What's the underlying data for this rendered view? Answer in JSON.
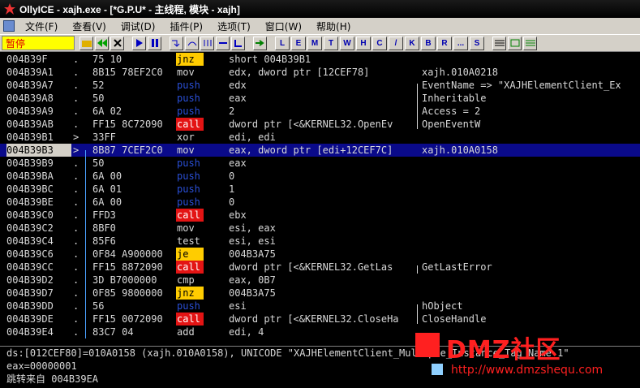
{
  "window": {
    "title": "OllyICE - xajh.exe - [*G.P.U* -  主线程, 模块 - xajh]"
  },
  "menu": [
    "文件(F)",
    "查看(V)",
    "调试(D)",
    "插件(P)",
    "选项(T)",
    "窗口(W)",
    "帮助(H)"
  ],
  "toolbar": {
    "status": "暂停",
    "letter_buttons": [
      "L",
      "E",
      "M",
      "T",
      "W",
      "H",
      "C",
      "/",
      "K",
      "B",
      "R",
      "...",
      "S"
    ]
  },
  "rows": [
    {
      "addr": "004B39F",
      "mark": ".",
      "hex": "75 10",
      "mnem": "jnz",
      "ops": "short 004B39B1",
      "cmt": "",
      "style": "jnz"
    },
    {
      "addr": "004B39A1",
      "mark": ".",
      "hex": "8B15 78EF2C0",
      "mnem": "mov",
      "ops": "edx, dword ptr [12CEF78]",
      "cmt": "xajh.010A0218",
      "style": "mov"
    },
    {
      "addr": "004B39A7",
      "mark": ".",
      "hex": "52",
      "mnem": "push",
      "ops": "edx",
      "cmt": "EventName => \"XAJHElementClient_Ex",
      "style": "push"
    },
    {
      "addr": "004B39A8",
      "mark": ".",
      "hex": "50",
      "mnem": "push",
      "ops": "eax",
      "cmt": "Inheritable",
      "style": "push"
    },
    {
      "addr": "004B39A9",
      "mark": ".",
      "hex": "6A 02",
      "mnem": "push",
      "ops": "2",
      "cmt": "Access = 2",
      "style": "push"
    },
    {
      "addr": "004B39AB",
      "mark": ".",
      "hex": "FF15 8C72090",
      "mnem": "call",
      "ops": "dword ptr [<&KERNEL32.OpenEv",
      "cmt": "OpenEventW",
      "style": "call"
    },
    {
      "addr": "004B39B1",
      "mark": ">",
      "hex": "33FF",
      "mnem": "xor",
      "ops": "edi, edi",
      "cmt": "",
      "style": "mov"
    },
    {
      "addr": "004B39B3",
      "mark": ">",
      "hex": "8B87 7CEF2C0",
      "mnem": "mov",
      "ops": "eax, dword ptr [edi+12CEF7C]",
      "cmt": "xajh.010A0158",
      "style": "mov"
    },
    {
      "addr": "004B39B9",
      "mark": ".",
      "hex": "50",
      "mnem": "push",
      "ops": "eax",
      "cmt": "",
      "style": "push"
    },
    {
      "addr": "004B39BA",
      "mark": ".",
      "hex": "6A 00",
      "mnem": "push",
      "ops": "0",
      "cmt": "",
      "style": "push"
    },
    {
      "addr": "004B39BC",
      "mark": ".",
      "hex": "6A 01",
      "mnem": "push",
      "ops": "1",
      "cmt": "",
      "style": "push"
    },
    {
      "addr": "004B39BE",
      "mark": ".",
      "hex": "6A 00",
      "mnem": "push",
      "ops": "0",
      "cmt": "",
      "style": "push"
    },
    {
      "addr": "004B39C0",
      "mark": ".",
      "hex": "FFD3",
      "mnem": "call",
      "ops": "ebx",
      "cmt": "",
      "style": "call"
    },
    {
      "addr": "004B39C2",
      "mark": ".",
      "hex": "8BF0",
      "mnem": "mov",
      "ops": "esi, eax",
      "cmt": "",
      "style": "mov"
    },
    {
      "addr": "004B39C4",
      "mark": ".",
      "hex": "85F6",
      "mnem": "test",
      "ops": "esi, esi",
      "cmt": "",
      "style": "mov"
    },
    {
      "addr": "004B39C6",
      "mark": ".",
      "hex": "0F84 A900000",
      "mnem": "je",
      "ops": "004B3A75",
      "cmt": "",
      "style": "je"
    },
    {
      "addr": "004B39CC",
      "mark": ".",
      "hex": "FF15 8872090",
      "mnem": "call",
      "ops": "dword ptr [<&KERNEL32.GetLas",
      "cmt": "GetLastError",
      "style": "call"
    },
    {
      "addr": "004B39D2",
      "mark": ".",
      "hex": "3D B7000000",
      "mnem": "cmp",
      "ops": "eax, 0B7",
      "cmt": "",
      "style": "mov"
    },
    {
      "addr": "004B39D7",
      "mark": ".",
      "hex": "0F85 9800000",
      "mnem": "jnz",
      "ops": "004B3A75",
      "cmt": "",
      "style": "jnz"
    },
    {
      "addr": "004B39DD",
      "mark": ".",
      "hex": "56",
      "mnem": "push",
      "ops": "esi",
      "cmt": "hObject",
      "style": "push"
    },
    {
      "addr": "004B39DE",
      "mark": ".",
      "hex": "FF15 0072090",
      "mnem": "call",
      "ops": "dword ptr [<&KERNEL32.CloseHa",
      "cmt": "CloseHandle",
      "style": "call"
    },
    {
      "addr": "004B39E4",
      "mark": ".",
      "hex": "83C7 04",
      "mnem": "add",
      "ops": "edi, 4",
      "cmt": "",
      "style": "mov"
    }
  ],
  "info": {
    "line1": "ds:[012CEF80]=010A0158 (xajh.010A0158), UNICODE \"XAJHElementClient_Multiple_Instance_Tag_Name_1\"",
    "line2": "eax=00000001",
    "line3": "跳转来自 004B39EA"
  },
  "watermark": {
    "brand": "DMZ社区",
    "url": "http://www.dmzshequ.com"
  }
}
